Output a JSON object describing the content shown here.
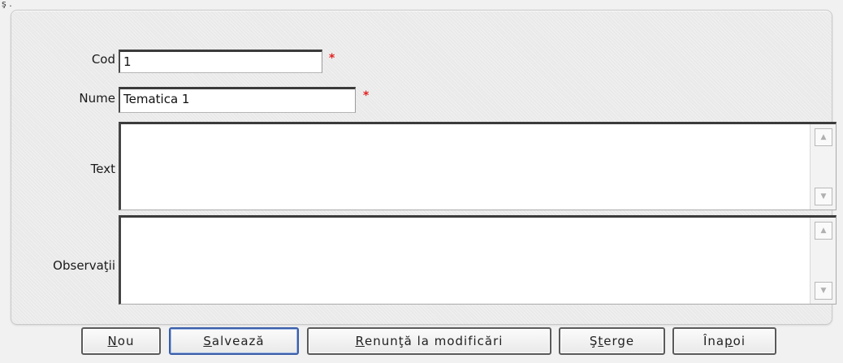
{
  "corner_text": "ş .",
  "form": {
    "cod": {
      "label": "Cod",
      "value": "1",
      "required_mark": "*"
    },
    "nume": {
      "label": "Nume",
      "value": "Tematica 1",
      "required_mark": "*"
    },
    "text": {
      "label": "Text",
      "value": ""
    },
    "observatii": {
      "label": "Observaţii",
      "value": ""
    }
  },
  "scrollbar": {
    "up_glyph": "▲",
    "down_glyph": "▼"
  },
  "buttons": {
    "nou": {
      "mnemonic": "N",
      "rest": "ou"
    },
    "salveaza": {
      "mnemonic": "S",
      "rest": "alvează"
    },
    "renunta": {
      "mnemonic": "R",
      "rest": "enunţă la modificări"
    },
    "sterge": {
      "pre": "Ş",
      "mnemonic": "t",
      "rest": "erge"
    },
    "inapoi": {
      "pre": "Îna",
      "mnemonic": "p",
      "rest": "oi"
    }
  }
}
